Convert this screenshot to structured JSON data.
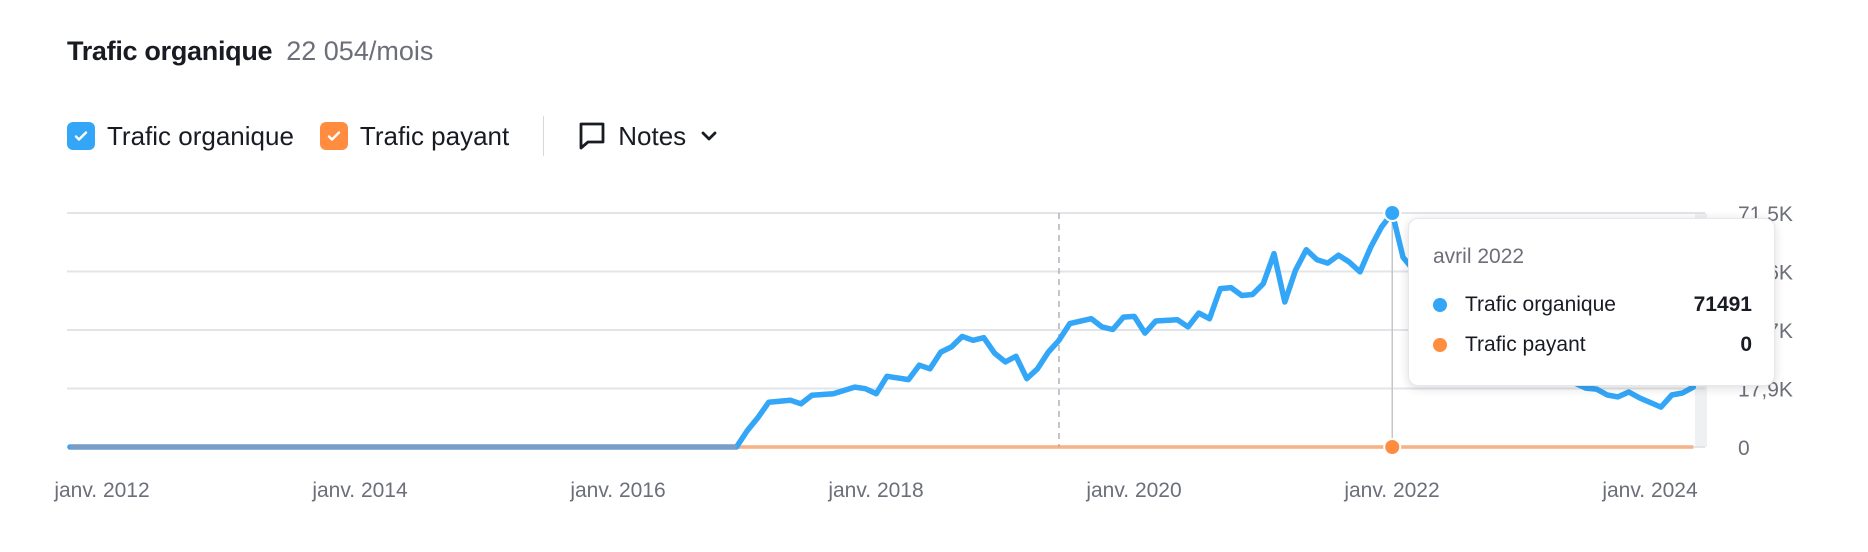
{
  "header": {
    "title": "Trafic organique",
    "subtitle": "22 054/mois"
  },
  "legend": {
    "items": [
      {
        "label": "Trafic organique",
        "color": "#33a6f7",
        "checked": true
      },
      {
        "label": "Trafic payant",
        "color": "#ff8c3f",
        "checked": true
      }
    ],
    "notes_label": "Notes",
    "notes_icon": "speech-bubble-icon",
    "chevron_icon": "chevron-down-icon"
  },
  "tooltip": {
    "date": "avril 2022",
    "rows": [
      {
        "label": "Trafic organique",
        "value": "71491",
        "color": "#33a6f7"
      },
      {
        "label": "Trafic payant",
        "value": "0",
        "color": "#ff8c3f"
      }
    ]
  },
  "chart_data": {
    "type": "line",
    "title": "",
    "xlabel": "",
    "ylabel": "",
    "x_range": [
      "2012-01",
      "2024-08"
    ],
    "ylim": [
      0,
      71500
    ],
    "y_ticks": [
      "0",
      "17,9K",
      "35,7K",
      "53,6K",
      "71,5K"
    ],
    "x_ticks": [
      {
        "date": "2012-01",
        "label": "janv. 2012"
      },
      {
        "date": "2014-01",
        "label": "janv. 2014"
      },
      {
        "date": "2016-01",
        "label": "janv. 2016"
      },
      {
        "date": "2018-01",
        "label": "janv. 2018"
      },
      {
        "date": "2020-01",
        "label": "janv. 2020"
      },
      {
        "date": "2022-01",
        "label": "janv. 2022"
      },
      {
        "date": "2024-01",
        "label": "janv. 2024"
      }
    ],
    "grid": true,
    "note_marker_date": "2019-09",
    "highlight_date": "2022-04",
    "series": [
      {
        "name": "Trafic organique",
        "color": "#33a6f7",
        "points": [
          [
            "2012-01",
            0
          ],
          [
            "2017-03",
            0
          ],
          [
            "2017-04",
            5000
          ],
          [
            "2017-05",
            9000
          ],
          [
            "2017-06",
            13700
          ],
          [
            "2017-08",
            14300
          ],
          [
            "2017-09",
            13200
          ],
          [
            "2017-10",
            15800
          ],
          [
            "2017-12",
            16300
          ],
          [
            "2018-02",
            18300
          ],
          [
            "2018-03",
            17800
          ],
          [
            "2018-04",
            16300
          ],
          [
            "2018-05",
            21600
          ],
          [
            "2018-07",
            20600
          ],
          [
            "2018-08",
            25000
          ],
          [
            "2018-09",
            23900
          ],
          [
            "2018-10",
            29000
          ],
          [
            "2018-11",
            30600
          ],
          [
            "2018-12",
            33800
          ],
          [
            "2019-01",
            32600
          ],
          [
            "2019-02",
            33400
          ],
          [
            "2019-03",
            28700
          ],
          [
            "2019-04",
            26000
          ],
          [
            "2019-05",
            27700
          ],
          [
            "2019-06",
            20900
          ],
          [
            "2019-07",
            23900
          ],
          [
            "2019-08",
            29000
          ],
          [
            "2019-09",
            32600
          ],
          [
            "2019-10",
            37700
          ],
          [
            "2019-12",
            39200
          ],
          [
            "2020-01",
            36700
          ],
          [
            "2020-02",
            35900
          ],
          [
            "2020-03",
            39700
          ],
          [
            "2020-04",
            39900
          ],
          [
            "2020-05",
            34800
          ],
          [
            "2020-06",
            38500
          ],
          [
            "2020-08",
            38900
          ],
          [
            "2020-09",
            36700
          ],
          [
            "2020-10",
            40900
          ],
          [
            "2020-11",
            39200
          ],
          [
            "2020-12",
            48400
          ],
          [
            "2021-01",
            48700
          ],
          [
            "2021-02",
            46300
          ],
          [
            "2021-03",
            46600
          ],
          [
            "2021-04",
            49900
          ],
          [
            "2021-05",
            59100
          ],
          [
            "2021-06",
            44300
          ],
          [
            "2021-07",
            54000
          ],
          [
            "2021-08",
            60300
          ],
          [
            "2021-09",
            57200
          ],
          [
            "2021-10",
            56200
          ],
          [
            "2021-11",
            58600
          ],
          [
            "2021-12",
            56500
          ],
          [
            "2022-01",
            53500
          ],
          [
            "2022-02",
            61100
          ],
          [
            "2022-03",
            67200
          ],
          [
            "2022-04",
            71491
          ],
          [
            "2022-05",
            58000
          ],
          [
            "2022-06",
            54000
          ],
          [
            "2022-08",
            48000
          ],
          [
            "2022-10",
            42000
          ],
          [
            "2022-12",
            38000
          ],
          [
            "2023-02",
            33000
          ],
          [
            "2023-04",
            28000
          ],
          [
            "2023-06",
            24000
          ],
          [
            "2023-08",
            21000
          ],
          [
            "2023-10",
            18000
          ],
          [
            "2023-11",
            17700
          ],
          [
            "2023-12",
            15900
          ],
          [
            "2024-01",
            15300
          ],
          [
            "2024-02",
            16800
          ],
          [
            "2024-03",
            15000
          ],
          [
            "2024-05",
            12200
          ],
          [
            "2024-06",
            15900
          ],
          [
            "2024-07",
            16500
          ],
          [
            "2024-08",
            18300
          ]
        ]
      },
      {
        "name": "Trafic payant",
        "color": "#ff8c3f",
        "points": [
          [
            "2012-01",
            0
          ],
          [
            "2024-08",
            0
          ]
        ]
      }
    ]
  }
}
